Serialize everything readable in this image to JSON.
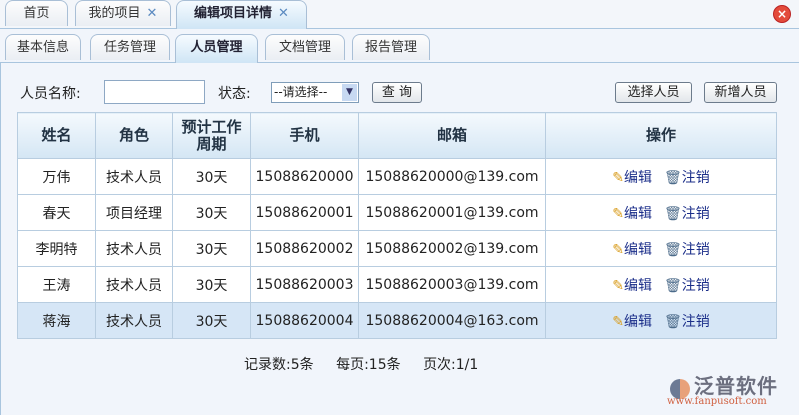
{
  "top_tabs": [
    {
      "label": "首页"
    },
    {
      "label": "我的项目"
    },
    {
      "label": "编辑项目详情"
    }
  ],
  "close_glyph": "✕",
  "sub_tabs": [
    {
      "label": "基本信息"
    },
    {
      "label": "任务管理"
    },
    {
      "label": "人员管理"
    },
    {
      "label": "文档管理"
    },
    {
      "label": "报告管理"
    }
  ],
  "search": {
    "name_label": "人员名称:",
    "name_value": "",
    "status_label": "状态:",
    "status_value": "--请选择--",
    "query_label": "查 询",
    "select_label": "选择人员",
    "add_label": "新增人员"
  },
  "table": {
    "headers": [
      "姓名",
      "角色",
      "预计工作周期",
      "手机",
      "邮箱",
      "操作"
    ],
    "rows": [
      {
        "name": "万伟",
        "role": "技术人员",
        "period": "30天",
        "phone": "15088620000",
        "email": "15088620000@139.com"
      },
      {
        "name": "春天",
        "role": "项目经理",
        "period": "30天",
        "phone": "15088620001",
        "email": "15088620001@139.com"
      },
      {
        "name": "李明特",
        "role": "技术人员",
        "period": "30天",
        "phone": "15088620002",
        "email": "15088620002@139.com"
      },
      {
        "name": "王涛",
        "role": "技术人员",
        "period": "30天",
        "phone": "15088620003",
        "email": "15088620003@139.com"
      },
      {
        "name": "蒋海",
        "role": "技术人员",
        "period": "30天",
        "phone": "15088620004",
        "email": "15088620004@163.com"
      }
    ],
    "edit_label": "编辑",
    "cancel_label": "注销"
  },
  "footer": {
    "records": "记录数:5条",
    "per_page": "每页:15条",
    "page": "页次:1/1"
  },
  "logo": {
    "name": "泛普软件",
    "url": "www.fanpusoft.com"
  }
}
